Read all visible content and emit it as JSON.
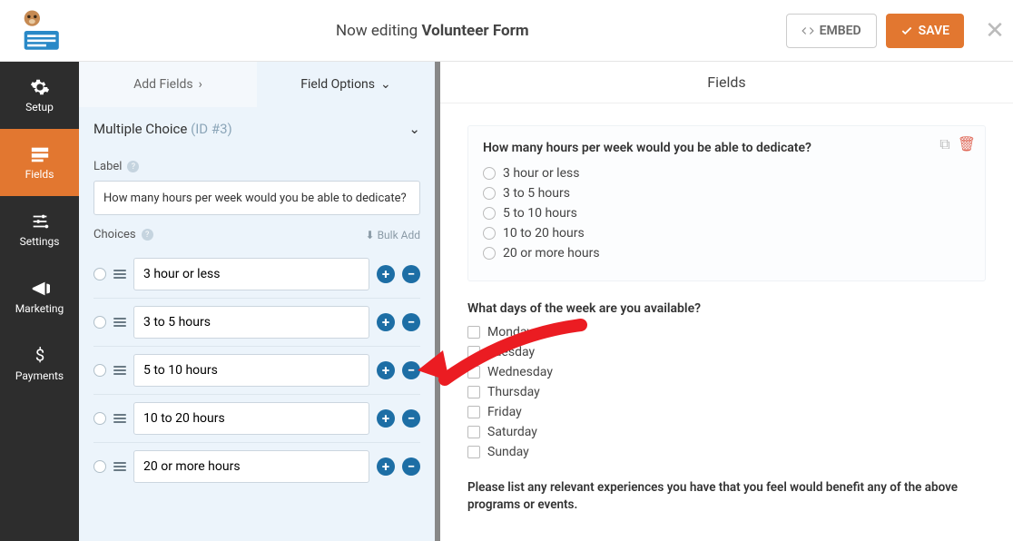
{
  "header": {
    "editing_prefix": "Now editing ",
    "form_name": "Volunteer Form",
    "embed_label": "EMBED",
    "save_label": "SAVE"
  },
  "rail": {
    "items": [
      {
        "label": "Setup"
      },
      {
        "label": "Fields"
      },
      {
        "label": "Settings"
      },
      {
        "label": "Marketing"
      },
      {
        "label": "Payments"
      }
    ]
  },
  "panel_title": "Fields",
  "tabs": {
    "add": "Add Fields",
    "options": "Field Options"
  },
  "section": {
    "name": "Multiple Choice",
    "id": "(ID #3)"
  },
  "label_heading": "Label",
  "label_value": "How many hours per week would you be able to dedicate?",
  "choices_heading": "Choices",
  "bulk_add": "Bulk Add",
  "choices": [
    {
      "text": "3 hour or less"
    },
    {
      "text": "3 to 5 hours"
    },
    {
      "text": "5 to 10 hours"
    },
    {
      "text": "10 to 20 hours"
    },
    {
      "text": "20 or more hours"
    }
  ],
  "preview": {
    "q1": "How many hours per week would you be able to dedicate?",
    "q1_opts": [
      "3 hour or less",
      "3 to 5 hours",
      "5 to 10 hours",
      "10 to 20 hours",
      "20 or more hours"
    ],
    "q2": "What days of the week are you available?",
    "q2_opts": [
      "Monday",
      "Tuesday",
      "Wednesday",
      "Thursday",
      "Friday",
      "Saturday",
      "Sunday"
    ],
    "q3": "Please list any relevant experiences you have that you feel would benefit any of the above programs or events."
  }
}
